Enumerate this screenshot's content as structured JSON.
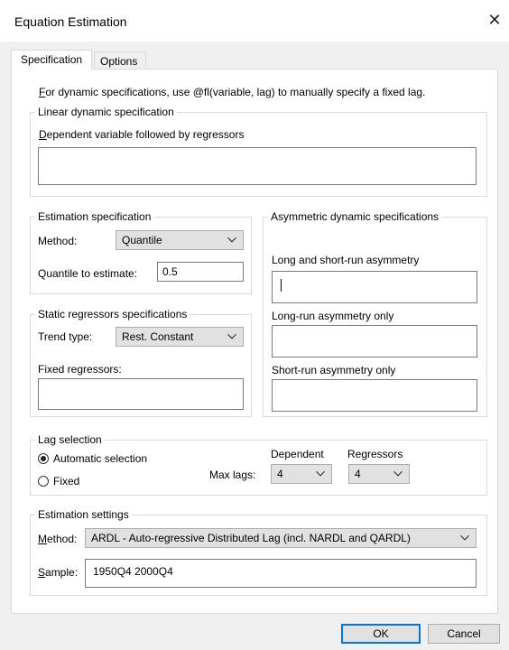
{
  "window": {
    "title": "Equation Estimation",
    "close_icon": "close-icon"
  },
  "tabs": [
    {
      "label": "Specification",
      "active": true
    },
    {
      "label": "Options",
      "active": false
    }
  ],
  "intro": {
    "u": "F",
    "rest": "or dynamic specifications, use @fl(variable, lag) to manually specify a fixed lag."
  },
  "linear": {
    "title": "Linear dynamic specification",
    "field_label_u": "D",
    "field_label_rest": "ependent variable followed by regressors",
    "value": ""
  },
  "estimation_spec": {
    "title": "Estimation specification",
    "method_label": "Method:",
    "method_value": "Quantile",
    "quantile_label": "Quantile to estimate:",
    "quantile_value": "0.5"
  },
  "static_regressors": {
    "title": "Static regressors specifications",
    "trend_label": "Trend type:",
    "trend_value": "Rest. Constant",
    "fixed_label": "Fixed regressors:",
    "fixed_value": ""
  },
  "asymmetric": {
    "title": "Asymmetric dynamic specifications",
    "long_short_label": "Long and short-run asymmetry",
    "long_only_label": "Long-run asymmetry only",
    "short_only_label": "Short-run asymmetry only"
  },
  "lag_selection": {
    "title": "Lag selection",
    "auto_label": "Automatic selection",
    "fixed_label": "Fixed",
    "selected": "auto",
    "max_lags_label": "Max lags:",
    "dependent_label": "Dependent",
    "dependent_value": "4",
    "regressors_label": "Regressors",
    "regressors_value": "4"
  },
  "estimation_settings": {
    "title": "Estimation settings",
    "method_label_u": "M",
    "method_label_rest": "ethod:",
    "method_value": "ARDL - Auto-regressive Distributed Lag (incl. NARDL and QARDL)",
    "sample_label_u": "S",
    "sample_label_rest": "ample:",
    "sample_value": "1950Q4 2000Q4"
  },
  "buttons": {
    "ok": "OK",
    "cancel": "Cancel"
  },
  "colors": {
    "accent": "#0078d7",
    "panel": "#ffffff",
    "dialog": "#f0f0f0"
  }
}
